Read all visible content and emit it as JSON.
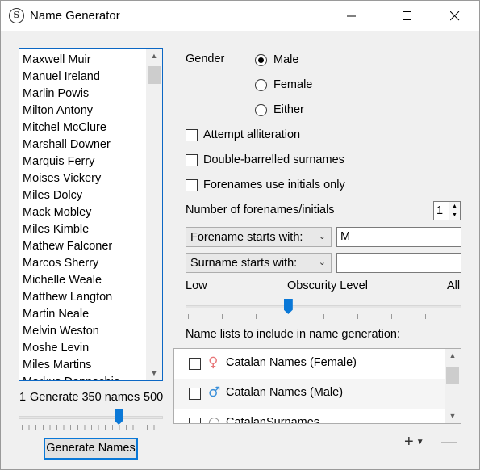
{
  "window": {
    "title": "Name Generator",
    "app_icon_letter": "S",
    "controls": [
      "minimize-icon",
      "maximize-icon",
      "close-icon"
    ]
  },
  "names_list": {
    "items": [
      "Maxwell Muir",
      "Manuel Ireland",
      "Marlin Powis",
      "Milton Antony",
      "Mitchel McClure",
      "Marshall Downer",
      "Marquis Ferry",
      "Moises Vickery",
      "Miles Dolcy",
      "Mack Mobley",
      "Miles Kimble",
      "Mathew Falconer",
      "Marcos Sherry",
      "Michelle Weale",
      "Matthew Langton",
      "Martin Neale",
      "Melvin Weston",
      "Moshe Levin",
      "Miles Martins",
      "Markus Donnachie"
    ],
    "scroll_up_icon": "chevron-up-icon",
    "scroll_down_icon": "chevron-down-icon"
  },
  "count_slider": {
    "min_label": "1",
    "caption": "Generate 350 names",
    "max_label": "500",
    "value": 350
  },
  "generate_button": {
    "label": "Generate Names"
  },
  "gender": {
    "label": "Gender",
    "options": [
      {
        "label": "Male",
        "selected": true
      },
      {
        "label": "Female",
        "selected": false
      },
      {
        "label": "Either",
        "selected": false
      }
    ]
  },
  "options": {
    "alliteration": {
      "label": "Attempt alliteration",
      "checked": false
    },
    "double_barrelled": {
      "label": "Double-barrelled surnames",
      "checked": false
    },
    "initials_only": {
      "label": "Forenames use initials only",
      "checked": false
    }
  },
  "forenames_count": {
    "label": "Number of forenames/initials",
    "value": "1"
  },
  "forename_filter": {
    "mode": "Forename starts with:",
    "value": "M"
  },
  "surname_filter": {
    "mode": "Surname starts with:",
    "value": ""
  },
  "obscurity": {
    "low_label": "Low",
    "caption": "Obscurity Level",
    "high_label": "All",
    "level_fraction": 0.37
  },
  "name_lists": {
    "label": "Name lists to include in name generation:",
    "items": [
      {
        "label": "Catalan Names (Female)",
        "icon": "female-icon",
        "color": "#e8787a",
        "checked": false
      },
      {
        "label": "Catalan Names (Male)",
        "icon": "male-icon",
        "color": "#3a8fd9",
        "checked": false
      },
      {
        "label": "CatalanSurnames",
        "icon": "surname-icon",
        "color": "#888888",
        "checked": false
      }
    ],
    "add_icon": "plus-icon",
    "remove_icon": "minus-icon"
  }
}
